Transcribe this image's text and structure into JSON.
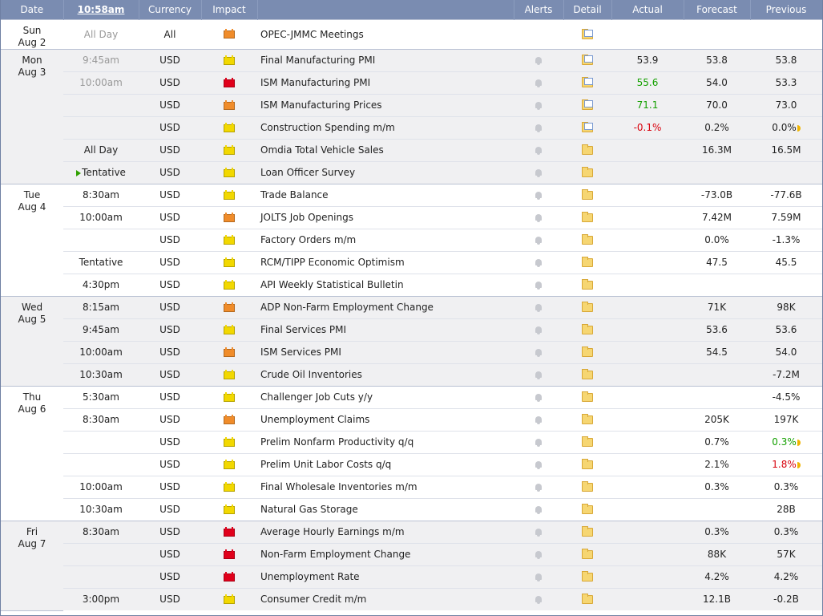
{
  "header": {
    "date": "Date",
    "time": "10:58am",
    "currency": "Currency",
    "impact": "Impact",
    "event": "",
    "alerts": "Alerts",
    "detail": "Detail",
    "actual": "Actual",
    "forecast": "Forecast",
    "previous": "Previous"
  },
  "colors": {
    "header_bg": "#7a8cb1",
    "impact_yellow": "#f2d800",
    "impact_orange": "#f08c2a",
    "impact_red": "#e0001b",
    "better": "#14a000",
    "worse": "#d8000c"
  },
  "days": [
    {
      "dow": "Sun",
      "date": "Aug 2",
      "shade": "white",
      "events": [
        {
          "time": "All Day",
          "time_dim": true,
          "currency": "All",
          "impact": "orange",
          "event": "OPEC-JMMC Meetings",
          "alert": false,
          "detail": "doc",
          "actual": "",
          "actual_tone": "",
          "forecast": "",
          "previous": "",
          "prev_tone": "",
          "prev_rev": false
        }
      ]
    },
    {
      "dow": "Mon",
      "date": "Aug 3",
      "shade": "gray",
      "events": [
        {
          "time": "9:45am",
          "time_dim": true,
          "currency": "USD",
          "impact": "yellow",
          "event": "Final Manufacturing PMI",
          "alert": true,
          "detail": "doc",
          "actual": "53.9",
          "actual_tone": "",
          "forecast": "53.8",
          "previous": "53.8",
          "prev_tone": "",
          "prev_rev": false
        },
        {
          "time": "10:00am",
          "time_dim": true,
          "currency": "USD",
          "impact": "red",
          "event": "ISM Manufacturing PMI",
          "alert": true,
          "detail": "doc",
          "actual": "55.6",
          "actual_tone": "green",
          "forecast": "54.0",
          "previous": "53.3",
          "prev_tone": "",
          "prev_rev": false
        },
        {
          "time": "",
          "time_dim": true,
          "currency": "USD",
          "impact": "orange",
          "event": "ISM Manufacturing Prices",
          "alert": true,
          "detail": "doc",
          "actual": "71.1",
          "actual_tone": "green",
          "forecast": "70.0",
          "previous": "73.0",
          "prev_tone": "",
          "prev_rev": false
        },
        {
          "time": "",
          "time_dim": true,
          "currency": "USD",
          "impact": "yellow",
          "event": "Construction Spending m/m",
          "alert": true,
          "detail": "doc",
          "actual": "-0.1%",
          "actual_tone": "red",
          "forecast": "0.2%",
          "previous": "0.0%",
          "prev_tone": "",
          "prev_rev": true
        },
        {
          "time": "All Day",
          "time_dim": false,
          "currency": "USD",
          "impact": "yellow",
          "event": "Omdia Total Vehicle Sales",
          "alert": true,
          "detail": "plain",
          "actual": "",
          "actual_tone": "",
          "forecast": "16.3M",
          "previous": "16.5M",
          "prev_tone": "",
          "prev_rev": false
        },
        {
          "time": "Tentative",
          "time_dim": false,
          "tentative_icon": true,
          "currency": "USD",
          "impact": "yellow",
          "event": "Loan Officer Survey",
          "alert": true,
          "detail": "plain",
          "actual": "",
          "actual_tone": "",
          "forecast": "",
          "previous": "",
          "prev_tone": "",
          "prev_rev": false
        }
      ]
    },
    {
      "dow": "Tue",
      "date": "Aug 4",
      "shade": "white",
      "events": [
        {
          "time": "8:30am",
          "time_dim": false,
          "currency": "USD",
          "impact": "yellow",
          "event": "Trade Balance",
          "alert": true,
          "detail": "plain",
          "actual": "",
          "actual_tone": "",
          "forecast": "-73.0B",
          "previous": "-77.6B",
          "prev_tone": "",
          "prev_rev": false
        },
        {
          "time": "10:00am",
          "time_dim": false,
          "currency": "USD",
          "impact": "orange",
          "event": "JOLTS Job Openings",
          "alert": true,
          "detail": "plain",
          "actual": "",
          "actual_tone": "",
          "forecast": "7.42M",
          "previous": "7.59M",
          "prev_tone": "",
          "prev_rev": false
        },
        {
          "time": "",
          "time_dim": false,
          "currency": "USD",
          "impact": "yellow",
          "event": "Factory Orders m/m",
          "alert": true,
          "detail": "plain",
          "actual": "",
          "actual_tone": "",
          "forecast": "0.0%",
          "previous": "-1.3%",
          "prev_tone": "",
          "prev_rev": false
        },
        {
          "time": "Tentative",
          "time_dim": false,
          "currency": "USD",
          "impact": "yellow",
          "event": "RCM/TIPP Economic Optimism",
          "alert": true,
          "detail": "plain",
          "actual": "",
          "actual_tone": "",
          "forecast": "47.5",
          "previous": "45.5",
          "prev_tone": "",
          "prev_rev": false
        },
        {
          "time": "4:30pm",
          "time_dim": false,
          "currency": "USD",
          "impact": "yellow",
          "event": "API Weekly Statistical Bulletin",
          "alert": true,
          "detail": "plain",
          "actual": "",
          "actual_tone": "",
          "forecast": "",
          "previous": "",
          "prev_tone": "",
          "prev_rev": false
        }
      ]
    },
    {
      "dow": "Wed",
      "date": "Aug 5",
      "shade": "gray",
      "events": [
        {
          "time": "8:15am",
          "time_dim": false,
          "currency": "USD",
          "impact": "orange",
          "event": "ADP Non-Farm Employment Change",
          "alert": true,
          "detail": "plain",
          "actual": "",
          "actual_tone": "",
          "forecast": "71K",
          "previous": "98K",
          "prev_tone": "",
          "prev_rev": false
        },
        {
          "time": "9:45am",
          "time_dim": false,
          "currency": "USD",
          "impact": "yellow",
          "event": "Final Services PMI",
          "alert": true,
          "detail": "plain",
          "actual": "",
          "actual_tone": "",
          "forecast": "53.6",
          "previous": "53.6",
          "prev_tone": "",
          "prev_rev": false
        },
        {
          "time": "10:00am",
          "time_dim": false,
          "currency": "USD",
          "impact": "orange",
          "event": "ISM Services PMI",
          "alert": true,
          "detail": "plain",
          "actual": "",
          "actual_tone": "",
          "forecast": "54.5",
          "previous": "54.0",
          "prev_tone": "",
          "prev_rev": false
        },
        {
          "time": "10:30am",
          "time_dim": false,
          "currency": "USD",
          "impact": "yellow",
          "event": "Crude Oil Inventories",
          "alert": true,
          "detail": "plain",
          "actual": "",
          "actual_tone": "",
          "forecast": "",
          "previous": "-7.2M",
          "prev_tone": "",
          "prev_rev": false
        }
      ]
    },
    {
      "dow": "Thu",
      "date": "Aug 6",
      "shade": "white",
      "events": [
        {
          "time": "5:30am",
          "time_dim": false,
          "currency": "USD",
          "impact": "yellow",
          "event": "Challenger Job Cuts y/y",
          "alert": true,
          "detail": "plain",
          "actual": "",
          "actual_tone": "",
          "forecast": "",
          "previous": "-4.5%",
          "prev_tone": "",
          "prev_rev": false
        },
        {
          "time": "8:30am",
          "time_dim": false,
          "currency": "USD",
          "impact": "orange",
          "event": "Unemployment Claims",
          "alert": true,
          "detail": "plain",
          "actual": "",
          "actual_tone": "",
          "forecast": "205K",
          "previous": "197K",
          "prev_tone": "",
          "prev_rev": false
        },
        {
          "time": "",
          "time_dim": false,
          "currency": "USD",
          "impact": "yellow",
          "event": "Prelim Nonfarm Productivity q/q",
          "alert": true,
          "detail": "plain",
          "actual": "",
          "actual_tone": "",
          "forecast": "0.7%",
          "previous": "0.3%",
          "prev_tone": "green",
          "prev_rev": true
        },
        {
          "time": "",
          "time_dim": false,
          "currency": "USD",
          "impact": "yellow",
          "event": "Prelim Unit Labor Costs q/q",
          "alert": true,
          "detail": "plain",
          "actual": "",
          "actual_tone": "",
          "forecast": "2.1%",
          "previous": "1.8%",
          "prev_tone": "red",
          "prev_rev": true
        },
        {
          "time": "10:00am",
          "time_dim": false,
          "currency": "USD",
          "impact": "yellow",
          "event": "Final Wholesale Inventories m/m",
          "alert": true,
          "detail": "plain",
          "actual": "",
          "actual_tone": "",
          "forecast": "0.3%",
          "previous": "0.3%",
          "prev_tone": "",
          "prev_rev": false
        },
        {
          "time": "10:30am",
          "time_dim": false,
          "currency": "USD",
          "impact": "yellow",
          "event": "Natural Gas Storage",
          "alert": true,
          "detail": "plain",
          "actual": "",
          "actual_tone": "",
          "forecast": "",
          "previous": "28B",
          "prev_tone": "",
          "prev_rev": false
        }
      ]
    },
    {
      "dow": "Fri",
      "date": "Aug 7",
      "shade": "gray",
      "events": [
        {
          "time": "8:30am",
          "time_dim": false,
          "currency": "USD",
          "impact": "red",
          "event": "Average Hourly Earnings m/m",
          "alert": true,
          "detail": "plain",
          "actual": "",
          "actual_tone": "",
          "forecast": "0.3%",
          "previous": "0.3%",
          "prev_tone": "",
          "prev_rev": false
        },
        {
          "time": "",
          "time_dim": false,
          "currency": "USD",
          "impact": "red",
          "event": "Non-Farm Employment Change",
          "alert": true,
          "detail": "plain",
          "actual": "",
          "actual_tone": "",
          "forecast": "88K",
          "previous": "57K",
          "prev_tone": "",
          "prev_rev": false
        },
        {
          "time": "",
          "time_dim": false,
          "currency": "USD",
          "impact": "red",
          "event": "Unemployment Rate",
          "alert": true,
          "detail": "plain",
          "actual": "",
          "actual_tone": "",
          "forecast": "4.2%",
          "previous": "4.2%",
          "prev_tone": "",
          "prev_rev": false
        },
        {
          "time": "3:00pm",
          "time_dim": false,
          "currency": "USD",
          "impact": "yellow",
          "event": "Consumer Credit m/m",
          "alert": true,
          "detail": "plain",
          "actual": "",
          "actual_tone": "",
          "forecast": "12.1B",
          "previous": "-0.2B",
          "prev_tone": "",
          "prev_rev": false
        }
      ]
    }
  ]
}
